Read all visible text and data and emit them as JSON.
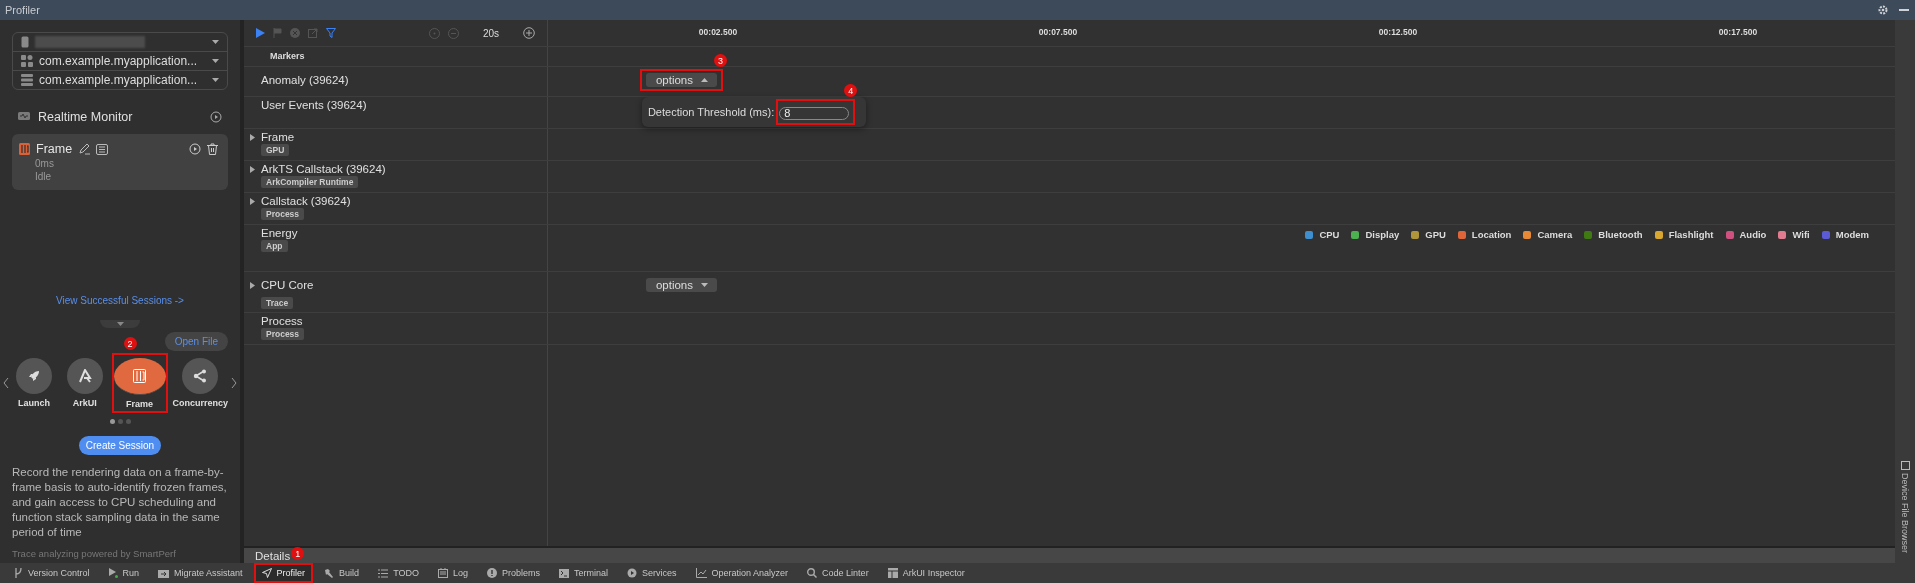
{
  "window": {
    "title": "Profiler"
  },
  "devices": [
    {
      "kind": "device",
      "redacted": true
    },
    {
      "kind": "app",
      "value": "com.example.myapplication..."
    },
    {
      "kind": "process",
      "value": "com.example.myapplication..."
    }
  ],
  "realtime_monitor": "Realtime Monitor",
  "session": {
    "name": "Frame",
    "duration": "0ms",
    "status": "Idle"
  },
  "view_sessions_link": "View Successful Sessions ->",
  "open_file": "Open File",
  "templates": [
    {
      "label": "Launch",
      "kind": "launch",
      "selected": false,
      "highlighted": false
    },
    {
      "label": "ArkUI",
      "kind": "arkui",
      "selected": false,
      "highlighted": false
    },
    {
      "label": "Frame",
      "kind": "frame",
      "selected": true,
      "highlighted": true,
      "badge": "2"
    },
    {
      "label": "Concurrency",
      "kind": "concurrency",
      "selected": false,
      "highlighted": false
    }
  ],
  "carousel_pages": [
    {
      "selected": true
    },
    {
      "selected": false
    },
    {
      "selected": false
    }
  ],
  "create_session": "Create Session",
  "description": "Record the rendering data on a frame-by-frame basis to auto-identify frozen frames, and gain access to CPU scheduling and function stack sampling data in the same period of time",
  "powered_by": "Trace analyzing powered by SmartPerf",
  "timeline": {
    "duration": "20s",
    "ticks": [
      "00:02.500",
      "00:07.500",
      "00:12.500",
      "00:17.500"
    ]
  },
  "tracks": [
    {
      "name": "Markers",
      "kind": "markers"
    },
    {
      "name": "Anomaly (39624)",
      "kind": "track",
      "expandable": false,
      "options": {
        "label": "options",
        "expanded": true,
        "highlighted": true,
        "badge": "3"
      }
    },
    {
      "name": "User Events (39624)",
      "kind": "track",
      "expandable": false
    },
    {
      "name": "Frame",
      "kind": "track",
      "expandable": true,
      "tag": "GPU"
    },
    {
      "name": "ArkTS Callstack (39624)",
      "kind": "track",
      "expandable": true,
      "tag": "ArkCompiler Runtime"
    },
    {
      "name": "Callstack (39624)",
      "kind": "track",
      "expandable": true,
      "tag": "Process"
    },
    {
      "name": "Energy",
      "kind": "energy",
      "expandable": false,
      "tag": "App"
    },
    {
      "name": "CPU Core",
      "kind": "track",
      "expandable": true,
      "tag": "Trace",
      "options": {
        "label": "options",
        "expanded": false,
        "highlighted": false
      }
    },
    {
      "name": "Process",
      "kind": "track",
      "expandable": false,
      "tag": "Process"
    }
  ],
  "threshold": {
    "label": "Detection Threshold (ms):",
    "value": "8",
    "highlighted": true,
    "badge": "4"
  },
  "legend": [
    {
      "label": "CPU",
      "color": "#3d8fd0"
    },
    {
      "label": "Display",
      "color": "#4caf50"
    },
    {
      "label": "GPU",
      "color": "#b0963a"
    },
    {
      "label": "Location",
      "color": "#e0663a"
    },
    {
      "label": "Camera",
      "color": "#e88a35"
    },
    {
      "label": "Bluetooth",
      "color": "#3f7a12"
    },
    {
      "label": "Flashlight",
      "color": "#d9a730"
    },
    {
      "label": "Audio",
      "color": "#d05080"
    },
    {
      "label": "Wifi",
      "color": "#e07b90"
    },
    {
      "label": "Modem",
      "color": "#5b5bd8"
    }
  ],
  "details": {
    "title": "Details",
    "badge": "1"
  },
  "tool_tabs": [
    {
      "label": "Version Control",
      "kind": "vcs",
      "selected": false,
      "highlighted": false
    },
    {
      "label": "Run",
      "kind": "run",
      "selected": false,
      "highlighted": false
    },
    {
      "label": "Migrate Assistant",
      "kind": "migrate",
      "selected": false,
      "highlighted": false
    },
    {
      "label": "Profiler",
      "kind": "profiler",
      "selected": true,
      "highlighted": true
    },
    {
      "label": "Build",
      "kind": "build",
      "selected": false,
      "highlighted": false
    },
    {
      "label": "TODO",
      "kind": "todo",
      "selected": false,
      "highlighted": false
    },
    {
      "label": "Log",
      "kind": "log",
      "selected": false,
      "highlighted": false
    },
    {
      "label": "Problems",
      "kind": "problems",
      "selected": false,
      "highlighted": false
    },
    {
      "label": "Terminal",
      "kind": "terminal",
      "selected": false,
      "highlighted": false
    },
    {
      "label": "Services",
      "kind": "services",
      "selected": false,
      "highlighted": false
    },
    {
      "label": "Operation Analyzer",
      "kind": "analyzer",
      "selected": false,
      "highlighted": false
    },
    {
      "label": "Code Linter",
      "kind": "linter",
      "selected": false,
      "highlighted": false
    },
    {
      "label": "ArkUI Inspector",
      "kind": "inspector",
      "selected": false,
      "highlighted": false
    }
  ],
  "side_tab": "Device File Browser"
}
